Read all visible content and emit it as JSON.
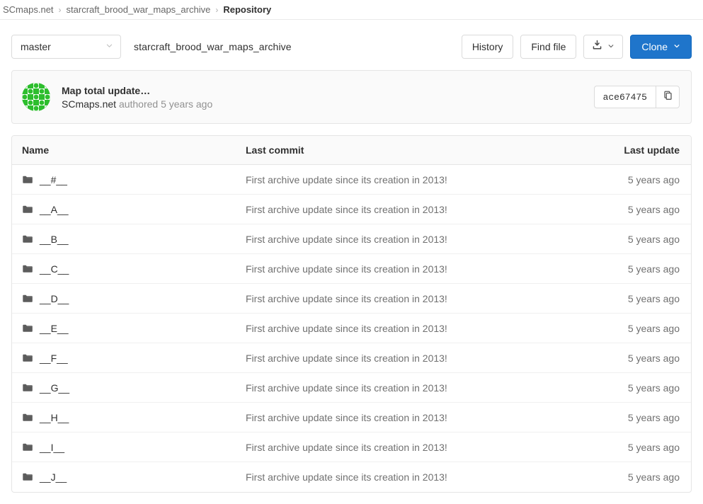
{
  "breadcrumb": {
    "items": [
      {
        "label": "SCmaps.net",
        "current": false
      },
      {
        "label": "starcraft_brood_war_maps_archive",
        "current": false
      },
      {
        "label": "Repository",
        "current": true
      }
    ],
    "separator": "›"
  },
  "toolbar": {
    "branch": "master",
    "repo_name": "starcraft_brood_war_maps_archive",
    "history_label": "History",
    "find_file_label": "Find file",
    "download_icon": "download-icon",
    "clone_label": "Clone"
  },
  "commit": {
    "title": "Map total update…",
    "author": "SCmaps.net",
    "meta": "authored 5 years ago",
    "sha": "ace67475",
    "copy_icon": "copy-to-clipboard-icon",
    "avatar_icon": "identicon-avatar"
  },
  "table": {
    "headers": {
      "name": "Name",
      "last_commit": "Last commit",
      "last_update": "Last update"
    },
    "rows": [
      {
        "name": "__#__",
        "commit": "First archive update since its creation in 2013!",
        "update": "5 years ago"
      },
      {
        "name": "__A__",
        "commit": "First archive update since its creation in 2013!",
        "update": "5 years ago"
      },
      {
        "name": "__B__",
        "commit": "First archive update since its creation in 2013!",
        "update": "5 years ago"
      },
      {
        "name": "__C__",
        "commit": "First archive update since its creation in 2013!",
        "update": "5 years ago"
      },
      {
        "name": "__D__",
        "commit": "First archive update since its creation in 2013!",
        "update": "5 years ago"
      },
      {
        "name": "__E__",
        "commit": "First archive update since its creation in 2013!",
        "update": "5 years ago"
      },
      {
        "name": "__F__",
        "commit": "First archive update since its creation in 2013!",
        "update": "5 years ago"
      },
      {
        "name": "__G__",
        "commit": "First archive update since its creation in 2013!",
        "update": "5 years ago"
      },
      {
        "name": "__H__",
        "commit": "First archive update since its creation in 2013!",
        "update": "5 years ago"
      },
      {
        "name": "__I__",
        "commit": "First archive update since its creation in 2013!",
        "update": "5 years ago"
      },
      {
        "name": "__J__",
        "commit": "First archive update since its creation in 2013!",
        "update": "5 years ago"
      }
    ]
  },
  "colors": {
    "primary_blue": "#1f75cb",
    "avatar_green": "#2bb02b",
    "text_dark": "#303030",
    "text_muted": "#707070",
    "border": "#e5e5e5"
  }
}
